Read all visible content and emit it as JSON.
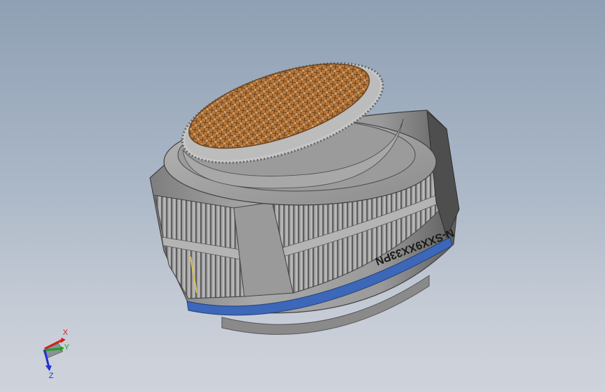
{
  "viewport": {
    "background_top": "#8fa0b4",
    "background_bottom": "#cfd3db"
  },
  "model": {
    "part_marking": "N-SXX9XX33PN",
    "colors": {
      "shell": "#9c9c9c",
      "shell_dark": "#6f6f6f",
      "insert": "#b87a3f",
      "seal_ring": "#3d67b8"
    }
  },
  "triad": {
    "x_label": "X",
    "y_label": "Y",
    "z_label": "Z",
    "x_color": "#d02020",
    "y_color": "#20a020",
    "z_color": "#2030d0"
  }
}
